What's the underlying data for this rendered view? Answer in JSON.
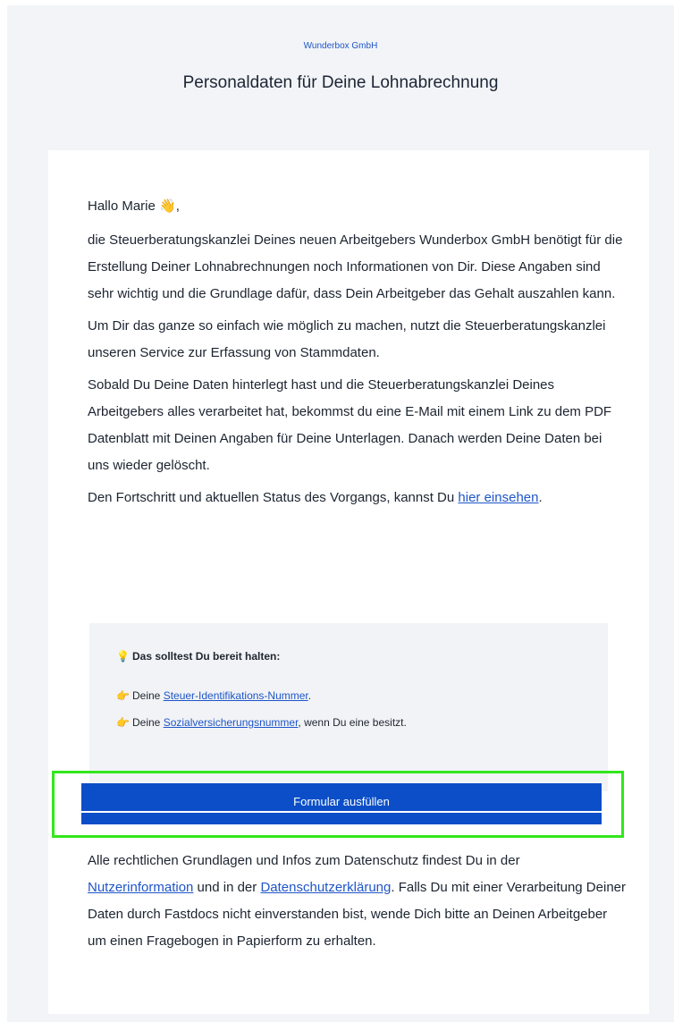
{
  "header": {
    "company": "Wunderbox GmbH",
    "title": "Personaldaten für Deine Lohnabrechnung"
  },
  "body": {
    "greeting_prefix": "Hallo Marie",
    "greeting_emoji": "👋",
    "greeting_suffix": ",",
    "paragraph1": "die Steuerberatungskanzlei Deines neuen Arbeitgebers Wunderbox GmbH benötigt für die Erstellung Deiner Lohnabrechnungen noch Informationen von Dir. Diese Angaben sind sehr wichtig und die Grundlage dafür, dass Dein Arbeitgeber das Gehalt auszahlen kann.",
    "paragraph2": "Um Dir das ganze so einfach wie möglich zu machen, nutzt die Steuerberatungskanzlei unseren Service zur Erfassung von Stammdaten.",
    "paragraph3": "Sobald Du Deine Daten hinterlegt hast und die Steuerberatungskanzlei Deines Arbeitgebers alles verarbeitet hat, bekommst du eine E-Mail mit einem Link zu dem PDF Datenblatt mit Deinen Angaben für Deine Unterlagen. Danach werden Deine Daten bei uns wieder gelöscht.",
    "paragraph4_prefix": "Den Fortschritt und aktuellen Status des Vorgangs, kannst Du ",
    "paragraph4_link": "hier einsehen",
    "paragraph4_suffix": "."
  },
  "checklist": {
    "title_emoji": "💡",
    "title": "Das solltest Du bereit halten:",
    "items": [
      {
        "emoji": "👉",
        "prefix": "Deine ",
        "link": "Steuer-Identifikations-Nummer",
        "suffix": "."
      },
      {
        "emoji": "👉",
        "prefix": "Deine ",
        "link": "Sozialversicherungsnummer",
        "suffix": ", wenn Du eine besitzt."
      }
    ]
  },
  "cta": {
    "label": "Formular ausfüllen",
    "highlight_color": "#33e61c",
    "button_color": "#0b4ec7"
  },
  "footer": {
    "text1": "Alle rechtlichen Grundlagen und Infos zum Datenschutz findest Du in der ",
    "link1": "Nutzerinformation",
    "text2": " und in der ",
    "link2": "Datenschutzerklärung",
    "text3": ". Falls Du mit einer Verarbeitung Deiner Daten durch Fastdocs nicht einverstanden bist, wende Dich bitte an Deinen Arbeitgeber um einen Fragebogen in Papierform zu erhalten."
  },
  "colors": {
    "link": "#1e55c8",
    "background": "#f2f4f7"
  }
}
